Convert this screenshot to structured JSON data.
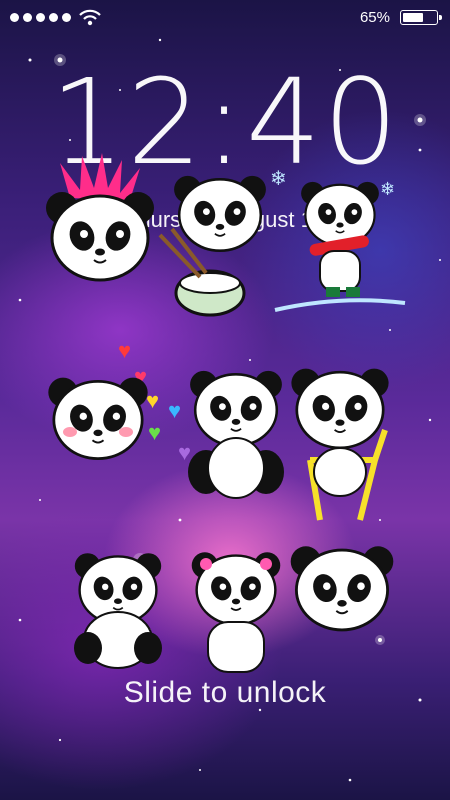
{
  "status_bar": {
    "signal_icon": "signal-dots-icon",
    "wifi_icon": "wifi-icon",
    "battery_percent": "65%",
    "battery_level": 0.65
  },
  "lockscreen": {
    "time": "12:40",
    "date": "Thursday, August 12",
    "unlock_hint": "Slide to unlock"
  },
  "wallpaper": {
    "theme": "galaxy panda stickers",
    "colors": {
      "deep": "#1b1446",
      "purple": "#5a2a9a",
      "pink": "#ff78d2",
      "mohawk": "#ff2d8a"
    }
  }
}
